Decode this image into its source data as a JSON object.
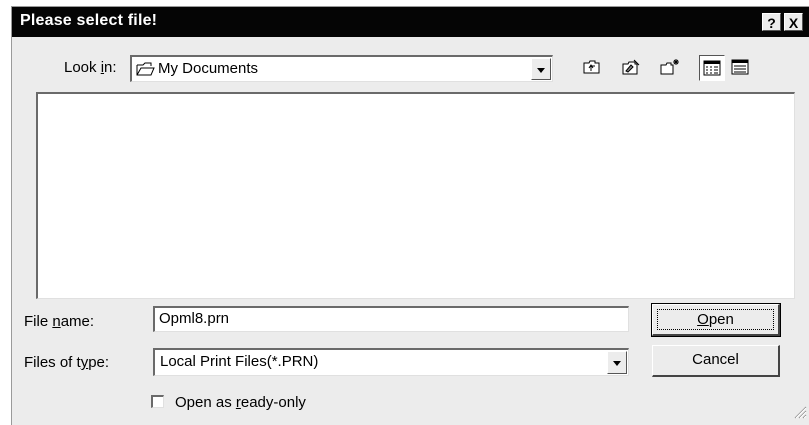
{
  "dialog": {
    "title": "Please select file!",
    "help_label": "?",
    "close_label": "X"
  },
  "lookin": {
    "label_pre": "Look ",
    "label_key": "i",
    "label_post": "n:",
    "value": "My Documents",
    "icon": "folder-icon"
  },
  "toolbar": {
    "tools": [
      "up-one-level-icon",
      "favorites-icon",
      "new-folder-icon",
      "list-view-icon",
      "details-view-icon"
    ]
  },
  "filename": {
    "label_pre": "File ",
    "label_key": "n",
    "label_post": "ame:",
    "value": "Opml8.prn"
  },
  "filetype": {
    "label_pre": "Files of t",
    "label_key": "y",
    "label_post": "pe:",
    "value": "Local Print Files(*.PRN)"
  },
  "buttons": {
    "open_key": "O",
    "open_rest": "pen",
    "cancel": "Cancel"
  },
  "readonly": {
    "label_pre": "Open as ",
    "label_key": "r",
    "label_post": "eady-only",
    "checked": false
  }
}
